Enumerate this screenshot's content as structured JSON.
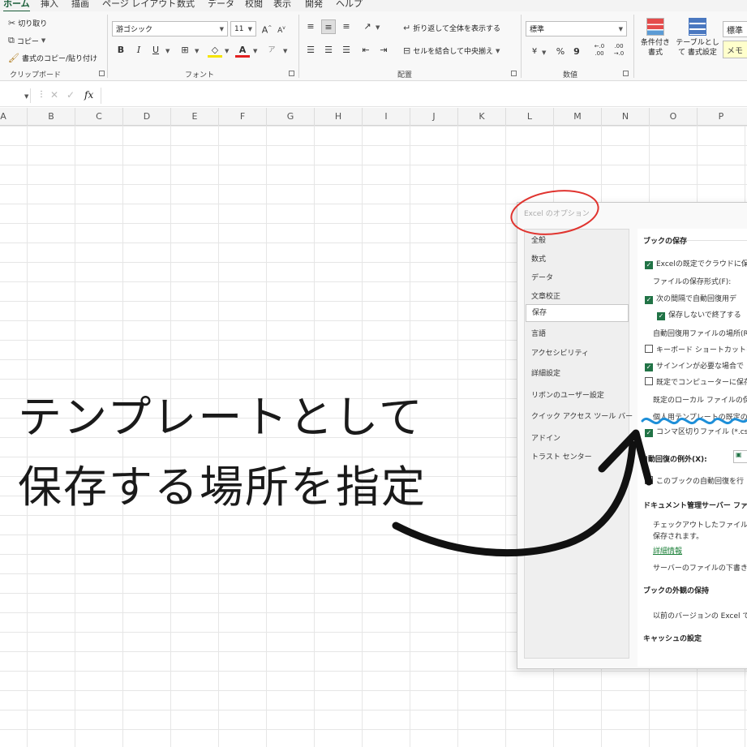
{
  "ribbon": {
    "tabs": [
      "ホーム",
      "挿入",
      "描画",
      "ページ レイアウト",
      "数式",
      "データ",
      "校閲",
      "表示",
      "開発",
      "ヘルプ"
    ],
    "clipboard": {
      "cut": "切り取り",
      "copy": "コピー",
      "format_painter": "書式のコピー/貼り付け",
      "group_label": "クリップボード"
    },
    "font": {
      "family": "游ゴシック",
      "size": "11",
      "bold": "B",
      "italic": "I",
      "underline": "U",
      "grow": "A",
      "shrink": "A",
      "font_color_letter": "A",
      "group_label": "フォント"
    },
    "alignment": {
      "wrap_text": "折り返して全体を表示する",
      "merge_center": "セルを結合して中央揃え",
      "group_label": "配置"
    },
    "number": {
      "format": "標準",
      "percent": "%",
      "comma": "9",
      "inc_decimal": "←.0 .00",
      "dec_decimal": ".00 →.0",
      "group_label": "数値"
    },
    "styles": {
      "conditional": "条件付き 書式",
      "table": "テーブルとして 書式設定",
      "style_normal": "標準",
      "style_memo": "メモ"
    }
  },
  "formula_bar": {
    "fx": "fx"
  },
  "columns": [
    "A",
    "B",
    "C",
    "D",
    "E",
    "F",
    "G",
    "H",
    "I",
    "J",
    "K",
    "L",
    "M",
    "N",
    "O",
    "P"
  ],
  "dialog": {
    "title": "Excel のオプション",
    "nav": [
      "全般",
      "数式",
      "データ",
      "文章校正",
      "保存",
      "言語",
      "アクセシビリティ",
      "詳細設定",
      "リボンのユーザー設定",
      "クイック アクセス ツール バー",
      "アドイン",
      "トラスト センター"
    ],
    "selected_nav": "保存",
    "main": {
      "section_save": "ブックの保存",
      "opt_cloud": "Excelの既定でクラウドに保",
      "file_format": "ファイルの保存形式(F):",
      "opt_autorecover": "次の間隔で自動回復用デ",
      "opt_keep_last": "保存しないで終了する",
      "autorecover_location": "自動回復用ファイルの場所(R",
      "opt_keyboard": "キーボード ショートカットを",
      "opt_signin": "サインインが必要な場合で",
      "opt_default_local": "既定でコンピューターに保存",
      "default_local_location": "既定のローカル ファイルの保存",
      "personal_template": "個人用テンプレートの既定の場",
      "opt_csv": "コンマ区切りファイル (*.cs",
      "autorecover_except": "自動回復の例外(X):",
      "opt_disable_autorecover": "このブックの自動回復を行",
      "section_docserver": "ドキュメント管理サーバー ファイ",
      "docserver_text1": "チェックアウトしたファイルをサー",
      "docserver_text2": "保存されます。",
      "details_link": "詳細情報",
      "drafts_text": "サーバーのファイルの下書きの",
      "section_appearance": "ブックの外観の保持",
      "appearance_text": "以前のバージョンの Excel で",
      "section_cache": "キャッシュの設定"
    }
  },
  "annotation": {
    "line1": "テンプレートとして",
    "line2": "保存する場所を指定"
  },
  "colors": {
    "excel_green": "#217346",
    "annotation_red": "#e0342f",
    "annotation_blue": "#1e8fd8",
    "ink": "#111111"
  }
}
